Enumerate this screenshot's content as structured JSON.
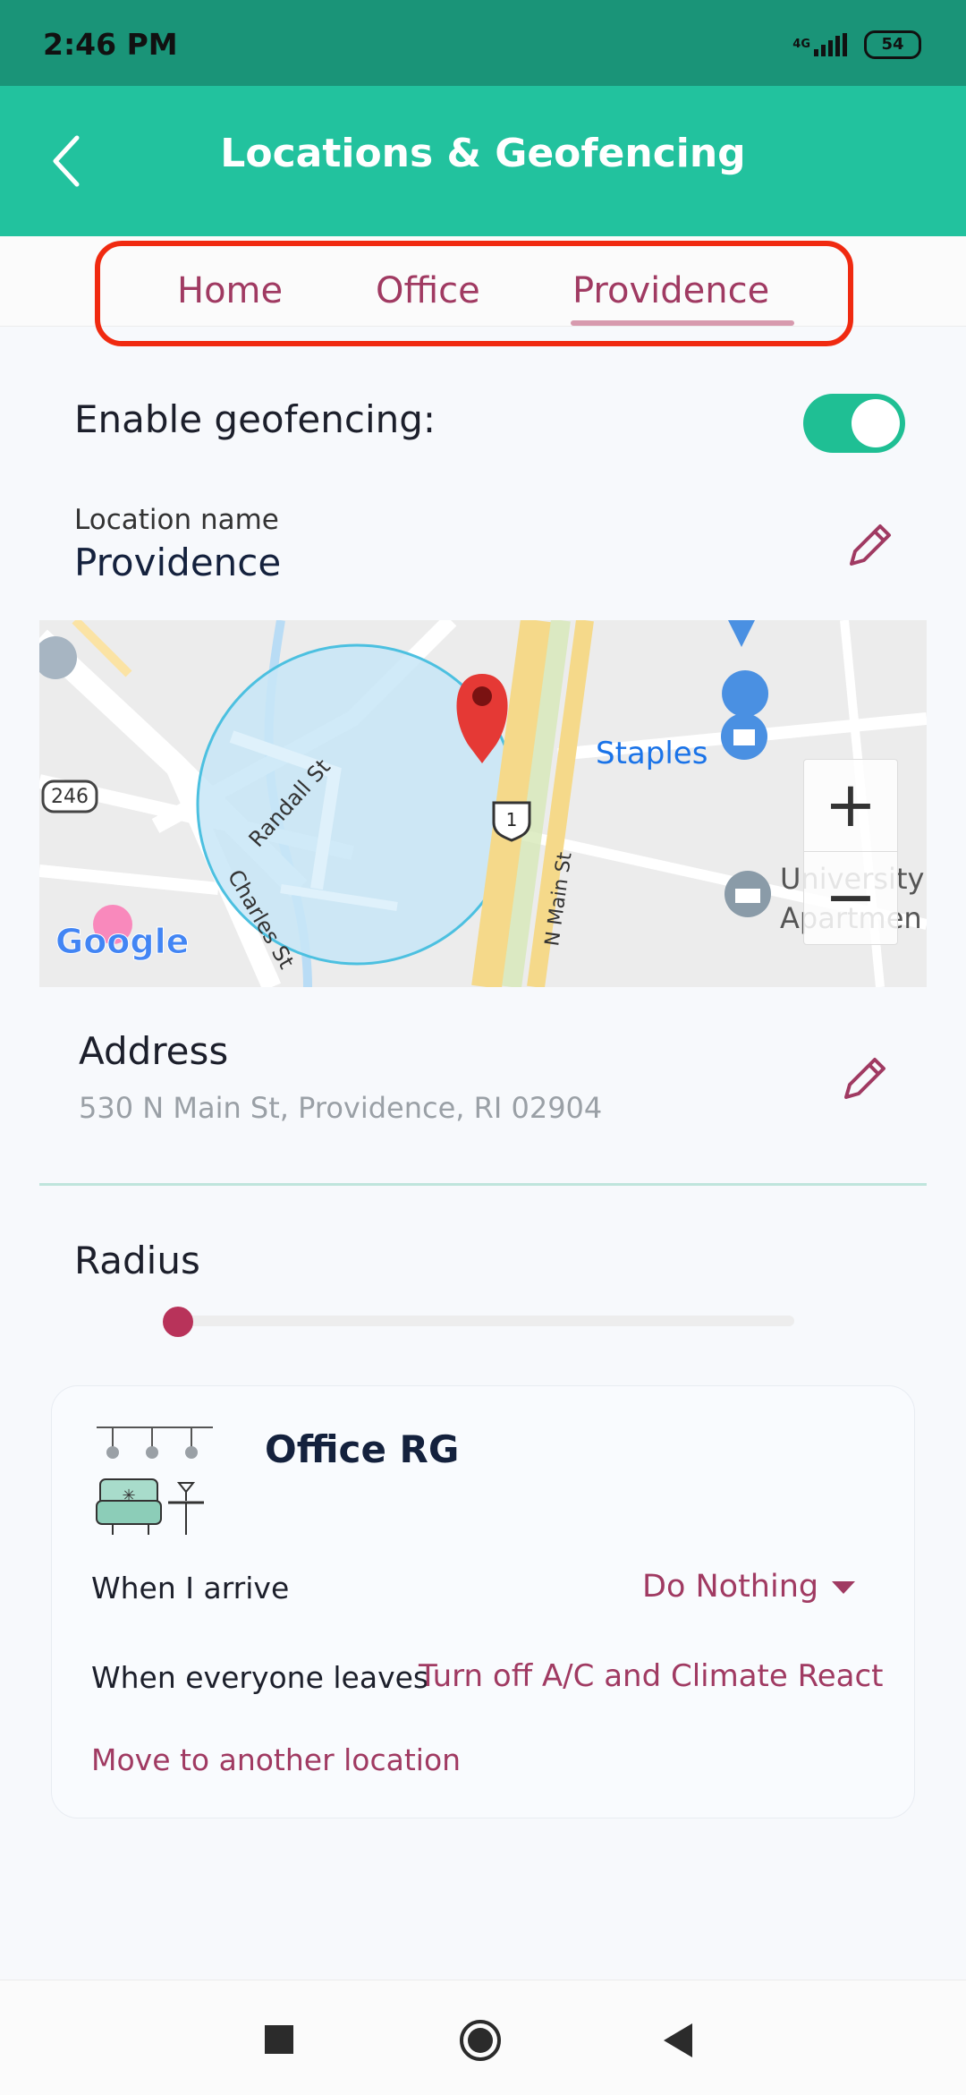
{
  "status_bar": {
    "time": "2:46 PM",
    "network": "4G",
    "battery": "54"
  },
  "app_bar": {
    "title": "Locations & Geofencing"
  },
  "tabs": [
    {
      "label": "Home"
    },
    {
      "label": "Office"
    },
    {
      "label": "Providence",
      "selected": true
    }
  ],
  "geofencing": {
    "label": "Enable geofencing:",
    "enabled": true
  },
  "location": {
    "caption": "Location name",
    "name": "Providence"
  },
  "map": {
    "labels": {
      "staples": "Staples",
      "randall": "Randall St",
      "charles": "Charles St",
      "nmain": "N Main St",
      "route": "246",
      "us_route": "1",
      "university": "University",
      "apartments": "Apartmen",
      "google": "Google"
    },
    "zoom_in": "+",
    "zoom_out": "−"
  },
  "address": {
    "label": "Address",
    "value": "530 N Main St,  Providence,  RI 02904"
  },
  "radius": {
    "label": "Radius",
    "value_fraction": 0.0
  },
  "device_card": {
    "name": "Office RG",
    "arrive_label": "When I arrive",
    "arrive_value": "Do Nothing",
    "leave_label": "When everyone leaves",
    "leave_value": "Turn off A/C and Climate React",
    "move_link": "Move to another location"
  },
  "colors": {
    "status_bar": "#1a9478",
    "app_bar": "#22c29e",
    "accent": "#a03a62",
    "toggle_on": "#1fbf94",
    "tab_highlight": "#f02a10",
    "slider_thumb": "#b8335a"
  },
  "icons": {
    "back": "chevron-left-icon",
    "edit": "pencil-icon",
    "dropdown": "caret-down-icon",
    "map_pin": "map-pin-icon",
    "nav_recent": "square-icon",
    "nav_home": "circle-icon",
    "nav_back": "triangle-left-icon"
  }
}
